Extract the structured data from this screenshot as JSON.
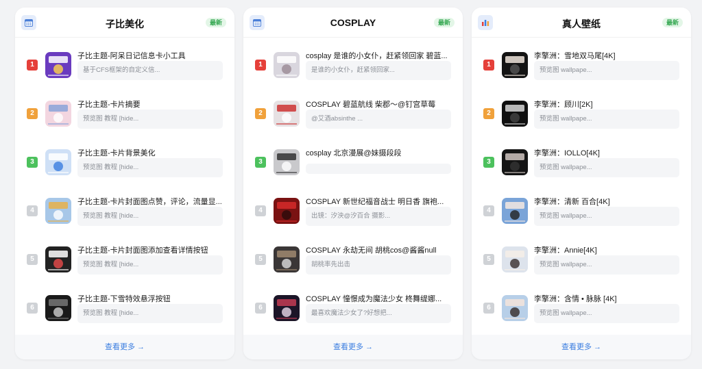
{
  "colors": {
    "rank1": "#e5403a",
    "rank2": "#f0a13b",
    "rank3": "#4cc15d",
    "rank_other": "#cfd2d6",
    "accent": "#3a7de0",
    "badge_text": "#36a852"
  },
  "cards": [
    {
      "title": "子比美化",
      "badge": "最新",
      "icon": "calendar-icon",
      "footer": "查看更多 →",
      "items": [
        {
          "rank": "1",
          "title": "子比主题-阿呆日记信息卡小工具",
          "desc": "基于CFS框架的自定义信..."
        },
        {
          "rank": "2",
          "title": "子比主题-卡片摘要",
          "desc": "预览图 教程 [hide..."
        },
        {
          "rank": "3",
          "title": "子比主题-卡片背景美化",
          "desc": "预览图 教程 [hide..."
        },
        {
          "rank": "4",
          "title": "子比主题-卡片封面图点赞，评论，流量显...",
          "desc": "预览图 教程 [hide..."
        },
        {
          "rank": "5",
          "title": "子比主题-卡片封面图添加查看详情按钮",
          "desc": "预览图 教程 [hide..."
        },
        {
          "rank": "6",
          "title": "子比主题-下雪特效悬浮按钮",
          "desc": "预览图 教程 [hide..."
        }
      ]
    },
    {
      "title": "COSPLAY",
      "badge": "最新",
      "icon": "calendar-icon",
      "footer": "查看更多 →",
      "items": [
        {
          "rank": "1",
          "title": "cosplay 是谁的小女仆，赶紧领回家 碧蓝...",
          "desc": "是谁的小女仆，赶紧领回家..."
        },
        {
          "rank": "2",
          "title": "COSPLAY 碧蓝航线 柴郡～@钉宫草莓",
          "desc": "@艾酒absinthe ..."
        },
        {
          "rank": "3",
          "title": "cosplay 北京漫展@妹摄段段",
          "desc": ""
        },
        {
          "rank": "4",
          "title": "COSPLAY 新世纪福音战士 明日香 旗袍...",
          "desc": "出镜：汐泱@汐百合 摄影..."
        },
        {
          "rank": "5",
          "title": "COSPLAY 永劫无间 胡桃cos@酱酱null",
          "desc": "胡桃率先出击"
        },
        {
          "rank": "6",
          "title": "COSPLAY 憧憬成为魔法少女 柊舞缇娜...",
          "desc": "最喜欢魔法少女了?好想把..."
        }
      ]
    },
    {
      "title": "真人壁纸",
      "badge": "最新",
      "icon": "bar-chart-icon",
      "footer": "查看更多 →",
      "items": [
        {
          "rank": "1",
          "title": "李擎洲：雪地双马尾[4K]",
          "desc": "预览图 wallpape..."
        },
        {
          "rank": "2",
          "title": "李擎洲：顾川[2K]",
          "desc": "预览图 wallpape..."
        },
        {
          "rank": "3",
          "title": "李擎洲：IOLLO[4K]",
          "desc": "预览图 wallpape..."
        },
        {
          "rank": "4",
          "title": "李擎洲：清新 百合[4K]",
          "desc": "预览图 wallpape..."
        },
        {
          "rank": "5",
          "title": "李擎洲：Annie[4K]",
          "desc": "预览图 wallpape..."
        },
        {
          "rank": "6",
          "title": "李擎洲：含情 • 脉脉 [4K]",
          "desc": "预览图 wallpape..."
        }
      ]
    }
  ]
}
